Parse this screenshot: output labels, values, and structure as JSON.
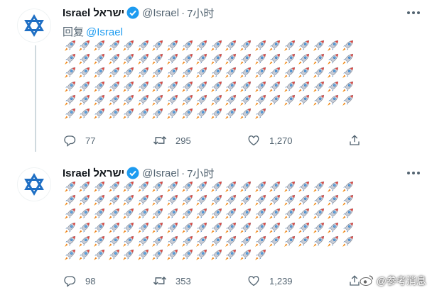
{
  "tweets": [
    {
      "display_name": "Israel ישראל",
      "handle": "@Israel",
      "separator": "·",
      "time": "7小时",
      "reply_prefix": "回复",
      "reply_mention": "@Israel",
      "rocket_rows": [
        20,
        20,
        20,
        20,
        20,
        14
      ],
      "stats": {
        "replies": "77",
        "retweets": "295",
        "likes": "1,270"
      }
    },
    {
      "display_name": "Israel ישראל",
      "handle": "@Israel",
      "separator": "·",
      "time": "7小时",
      "rocket_rows": [
        20,
        20,
        20,
        20,
        20,
        14
      ],
      "stats": {
        "replies": "98",
        "retweets": "353",
        "likes": "1,239"
      }
    }
  ],
  "watermark": {
    "text": "@参考消息"
  },
  "colors": {
    "text": "#0f1419",
    "muted": "#536471",
    "accent": "#1d9bf0",
    "verified": "#1d9bf0",
    "star": "#1f6fc4"
  },
  "icons": [
    "star-of-david-icon",
    "verified-badge-icon",
    "more-icon",
    "reply-icon",
    "retweet-icon",
    "like-icon",
    "share-icon",
    "rocket-icon",
    "weibo-logo-icon"
  ]
}
